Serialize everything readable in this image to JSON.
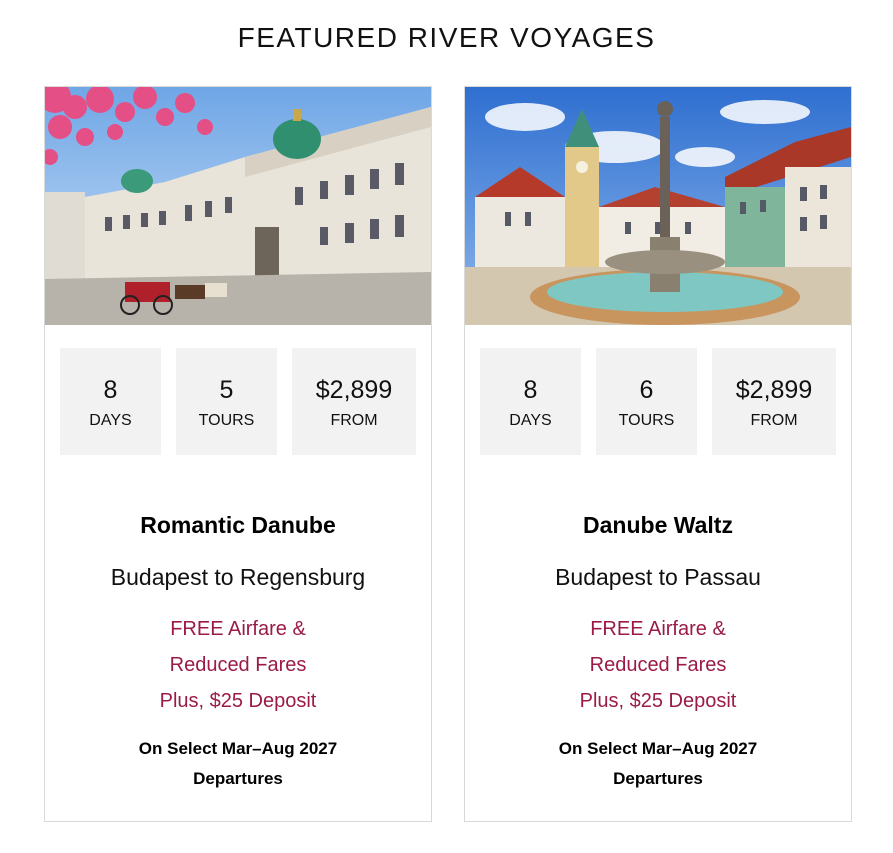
{
  "header": {
    "title": "FEATURED RIVER VOYAGES"
  },
  "voyages": [
    {
      "image_alt": "Vienna Hofburg palace with horse carriage",
      "stats": [
        {
          "value": "8",
          "label": "DAYS"
        },
        {
          "value": "5",
          "label": "TOURS"
        },
        {
          "value": "$2,899",
          "label": "FROM"
        }
      ],
      "name": "Romantic Danube",
      "route": "Budapest to Regensburg",
      "promo": [
        "FREE Airfare &",
        "Reduced Fares",
        "Plus, $25 Deposit"
      ],
      "departures": [
        "On Select Mar–Aug 2027",
        "Departures"
      ]
    },
    {
      "image_alt": "Bratislava main square with fountain and old town hall",
      "stats": [
        {
          "value": "8",
          "label": "DAYS"
        },
        {
          "value": "6",
          "label": "TOURS"
        },
        {
          "value": "$2,899",
          "label": "FROM"
        }
      ],
      "name": "Danube Waltz",
      "route": "Budapest to Passau",
      "promo": [
        "FREE Airfare &",
        "Reduced Fares",
        "Plus, $25 Deposit"
      ],
      "departures": [
        "On Select Mar–Aug 2027",
        "Departures"
      ]
    }
  ],
  "colors": {
    "promo": "#9b1b44",
    "stat_bg": "#f2f2f2",
    "border": "#d9d9d9"
  }
}
